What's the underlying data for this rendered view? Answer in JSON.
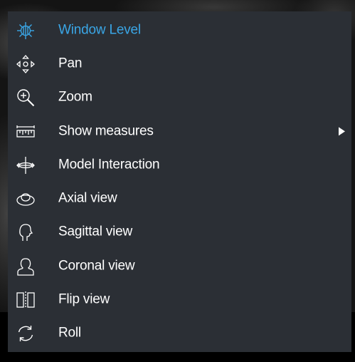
{
  "colors": {
    "menu_background": "#2b2f35",
    "accent": "#3aa6e6",
    "text": "#ffffff"
  },
  "menu": {
    "items": [
      {
        "label": "Window Level",
        "icon": "window-level-icon",
        "active": true,
        "has_submenu": false
      },
      {
        "label": "Pan",
        "icon": "pan-icon",
        "active": false,
        "has_submenu": false
      },
      {
        "label": "Zoom",
        "icon": "zoom-icon",
        "active": false,
        "has_submenu": false
      },
      {
        "label": "Show measures",
        "icon": "ruler-icon",
        "active": false,
        "has_submenu": true
      },
      {
        "label": "Model Interaction",
        "icon": "model-interaction-icon",
        "active": false,
        "has_submenu": false
      },
      {
        "label": "Axial view",
        "icon": "axial-view-icon",
        "active": false,
        "has_submenu": false
      },
      {
        "label": "Sagittal view",
        "icon": "sagittal-view-icon",
        "active": false,
        "has_submenu": false
      },
      {
        "label": "Coronal view",
        "icon": "coronal-view-icon",
        "active": false,
        "has_submenu": false
      },
      {
        "label": "Flip view",
        "icon": "flip-view-icon",
        "active": false,
        "has_submenu": false
      },
      {
        "label": "Roll",
        "icon": "roll-icon",
        "active": false,
        "has_submenu": false
      }
    ]
  }
}
